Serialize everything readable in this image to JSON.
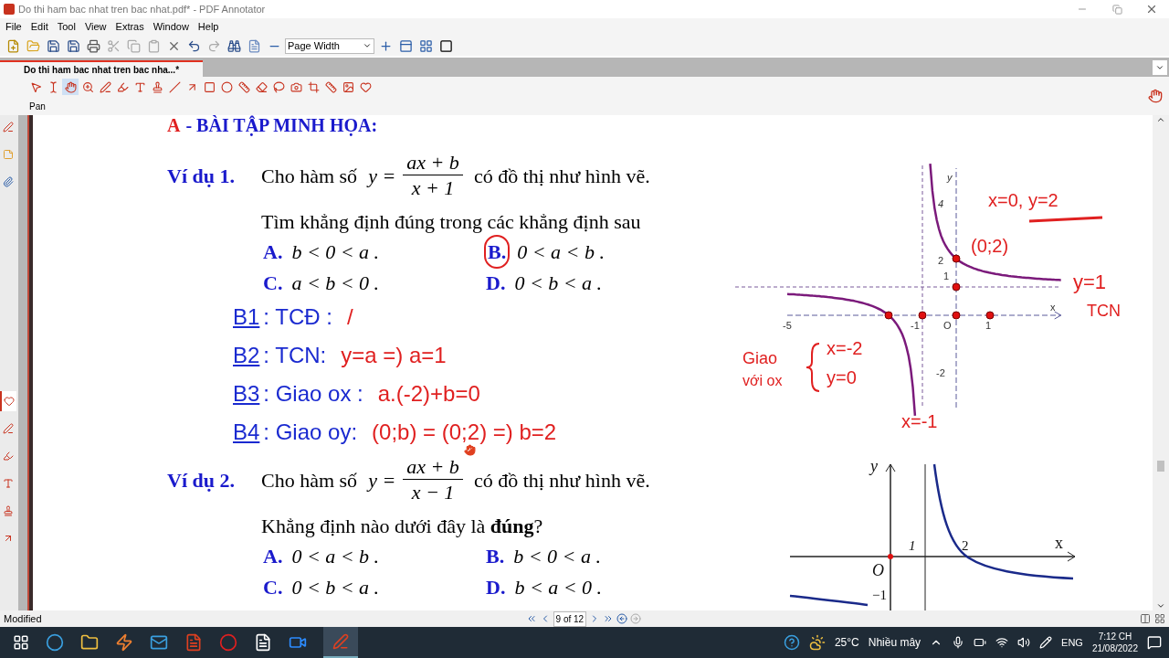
{
  "window": {
    "title": "Do thi ham bac nhat tren bac nhat.pdf* - PDF Annotator"
  },
  "menu": [
    "File",
    "Edit",
    "Tool",
    "View",
    "Extras",
    "Window",
    "Help"
  ],
  "toolbar": {
    "zoom_mode": "Page Width"
  },
  "tabs": [
    {
      "label": "Do thi ham bac nhat tren bac nha...*",
      "selected": true
    }
  ],
  "annotation_tools": [
    {
      "kind": "select",
      "selected": false
    },
    {
      "kind": "text-select",
      "selected": false
    },
    {
      "kind": "pan",
      "selected": true
    },
    {
      "kind": "zoom",
      "selected": false
    },
    {
      "kind": "pen",
      "selected": false
    },
    {
      "kind": "highlighter",
      "selected": false
    },
    {
      "kind": "textbox",
      "selected": false
    },
    {
      "kind": "stamp",
      "selected": false
    },
    {
      "kind": "line",
      "selected": false
    },
    {
      "kind": "arrow",
      "selected": false
    },
    {
      "kind": "rectangle",
      "selected": false
    },
    {
      "kind": "ellipse",
      "selected": false
    },
    {
      "kind": "measure",
      "selected": false
    },
    {
      "kind": "eraser",
      "selected": false
    },
    {
      "kind": "lasso",
      "selected": false
    },
    {
      "kind": "camera",
      "selected": false
    },
    {
      "kind": "crop",
      "selected": false
    },
    {
      "kind": "ruler",
      "selected": false
    },
    {
      "kind": "image",
      "selected": false
    },
    {
      "kind": "favorite",
      "selected": false
    }
  ],
  "tool_label": "Pan",
  "sidebar_tabs": [
    {
      "kind": "pen",
      "selected": false
    },
    {
      "kind": "note",
      "selected": false
    },
    {
      "kind": "attachment",
      "selected": false
    },
    {
      "kind": "favorite",
      "selected": true
    },
    {
      "kind": "pen",
      "selected": false
    },
    {
      "kind": "highlighter",
      "selected": false
    },
    {
      "kind": "textbox",
      "selected": false
    },
    {
      "kind": "stamp",
      "selected": false
    },
    {
      "kind": "arrow",
      "selected": false
    }
  ],
  "document": {
    "heading": {
      "letter": "A",
      "text": "- BÀI TẬP MINH HỌA:"
    },
    "examples": [
      {
        "label": "Ví dụ 1.",
        "intro": "Cho hàm số",
        "formula": {
          "lhs": "y =",
          "numerator": "ax + b",
          "denominator": "x + 1"
        },
        "outro": "có đồ thị như hình vẽ.",
        "prompt": "Tìm khẳng định đúng trong các khẳng định sau",
        "options": [
          {
            "letter": "A.",
            "text": "b < 0 < a .",
            "circled": false
          },
          {
            "letter": "B.",
            "text": "0 < a < b .",
            "circled": true
          },
          {
            "letter": "C.",
            "text": "a < b < 0 .",
            "circled": false
          },
          {
            "letter": "D.",
            "text": "0 < b < a .",
            "circled": false
          }
        ],
        "notes": [
          {
            "step": "B1",
            "label": ": TCĐ :",
            "work": "/"
          },
          {
            "step": "B2",
            "label": ": TCN:",
            "work": "y=a =) a=1"
          },
          {
            "step": "B3",
            "label": ": Giao ox :",
            "work": "a.(-2)+b=0"
          },
          {
            "step": "B4",
            "label": ": Giao oy:",
            "work": "(0;b) = (0;2) =) b=2"
          }
        ],
        "graph": {
          "kind": "hyperbola-annotated",
          "labels": [
            "y",
            "4",
            "2",
            "1",
            "x",
            "-5",
            "-1",
            "O",
            "1",
            "-2"
          ],
          "annotations": [
            "x=0, y=2",
            "(0;2)",
            "y=1",
            "TCN",
            "Giao",
            "với ox",
            "x=-2",
            "y=0",
            "x=-1"
          ]
        }
      },
      {
        "label": "Ví dụ 2.",
        "intro": "Cho hàm số",
        "formula": {
          "lhs": "y =",
          "numerator": "ax + b",
          "denominator": "x − 1"
        },
        "outro": "có đồ thị như hình vẽ.",
        "prompt": "Khẳng định nào dưới đây là **đúng**?",
        "options": [
          {
            "letter": "A.",
            "text": "0 < a < b .",
            "circled": false
          },
          {
            "letter": "B.",
            "text": "b < 0 < a .",
            "circled": false
          },
          {
            "letter": "C.",
            "text": "0 < b < a .",
            "circled": false
          },
          {
            "letter": "D.",
            "text": "b < a < 0 .",
            "circled": false
          }
        ],
        "graph": {
          "kind": "hyperbola-plain",
          "labels": [
            "y",
            "1",
            "2",
            "x",
            "O",
            "−1"
          ]
        }
      }
    ]
  },
  "status_bar": {
    "text": "Modified",
    "page": "9 of 12"
  },
  "taskbar": {
    "temperature": "25°C",
    "weather": "Nhiều mây",
    "language": "ENG",
    "time": "7:12 CH",
    "date": "21/08/2022"
  }
}
